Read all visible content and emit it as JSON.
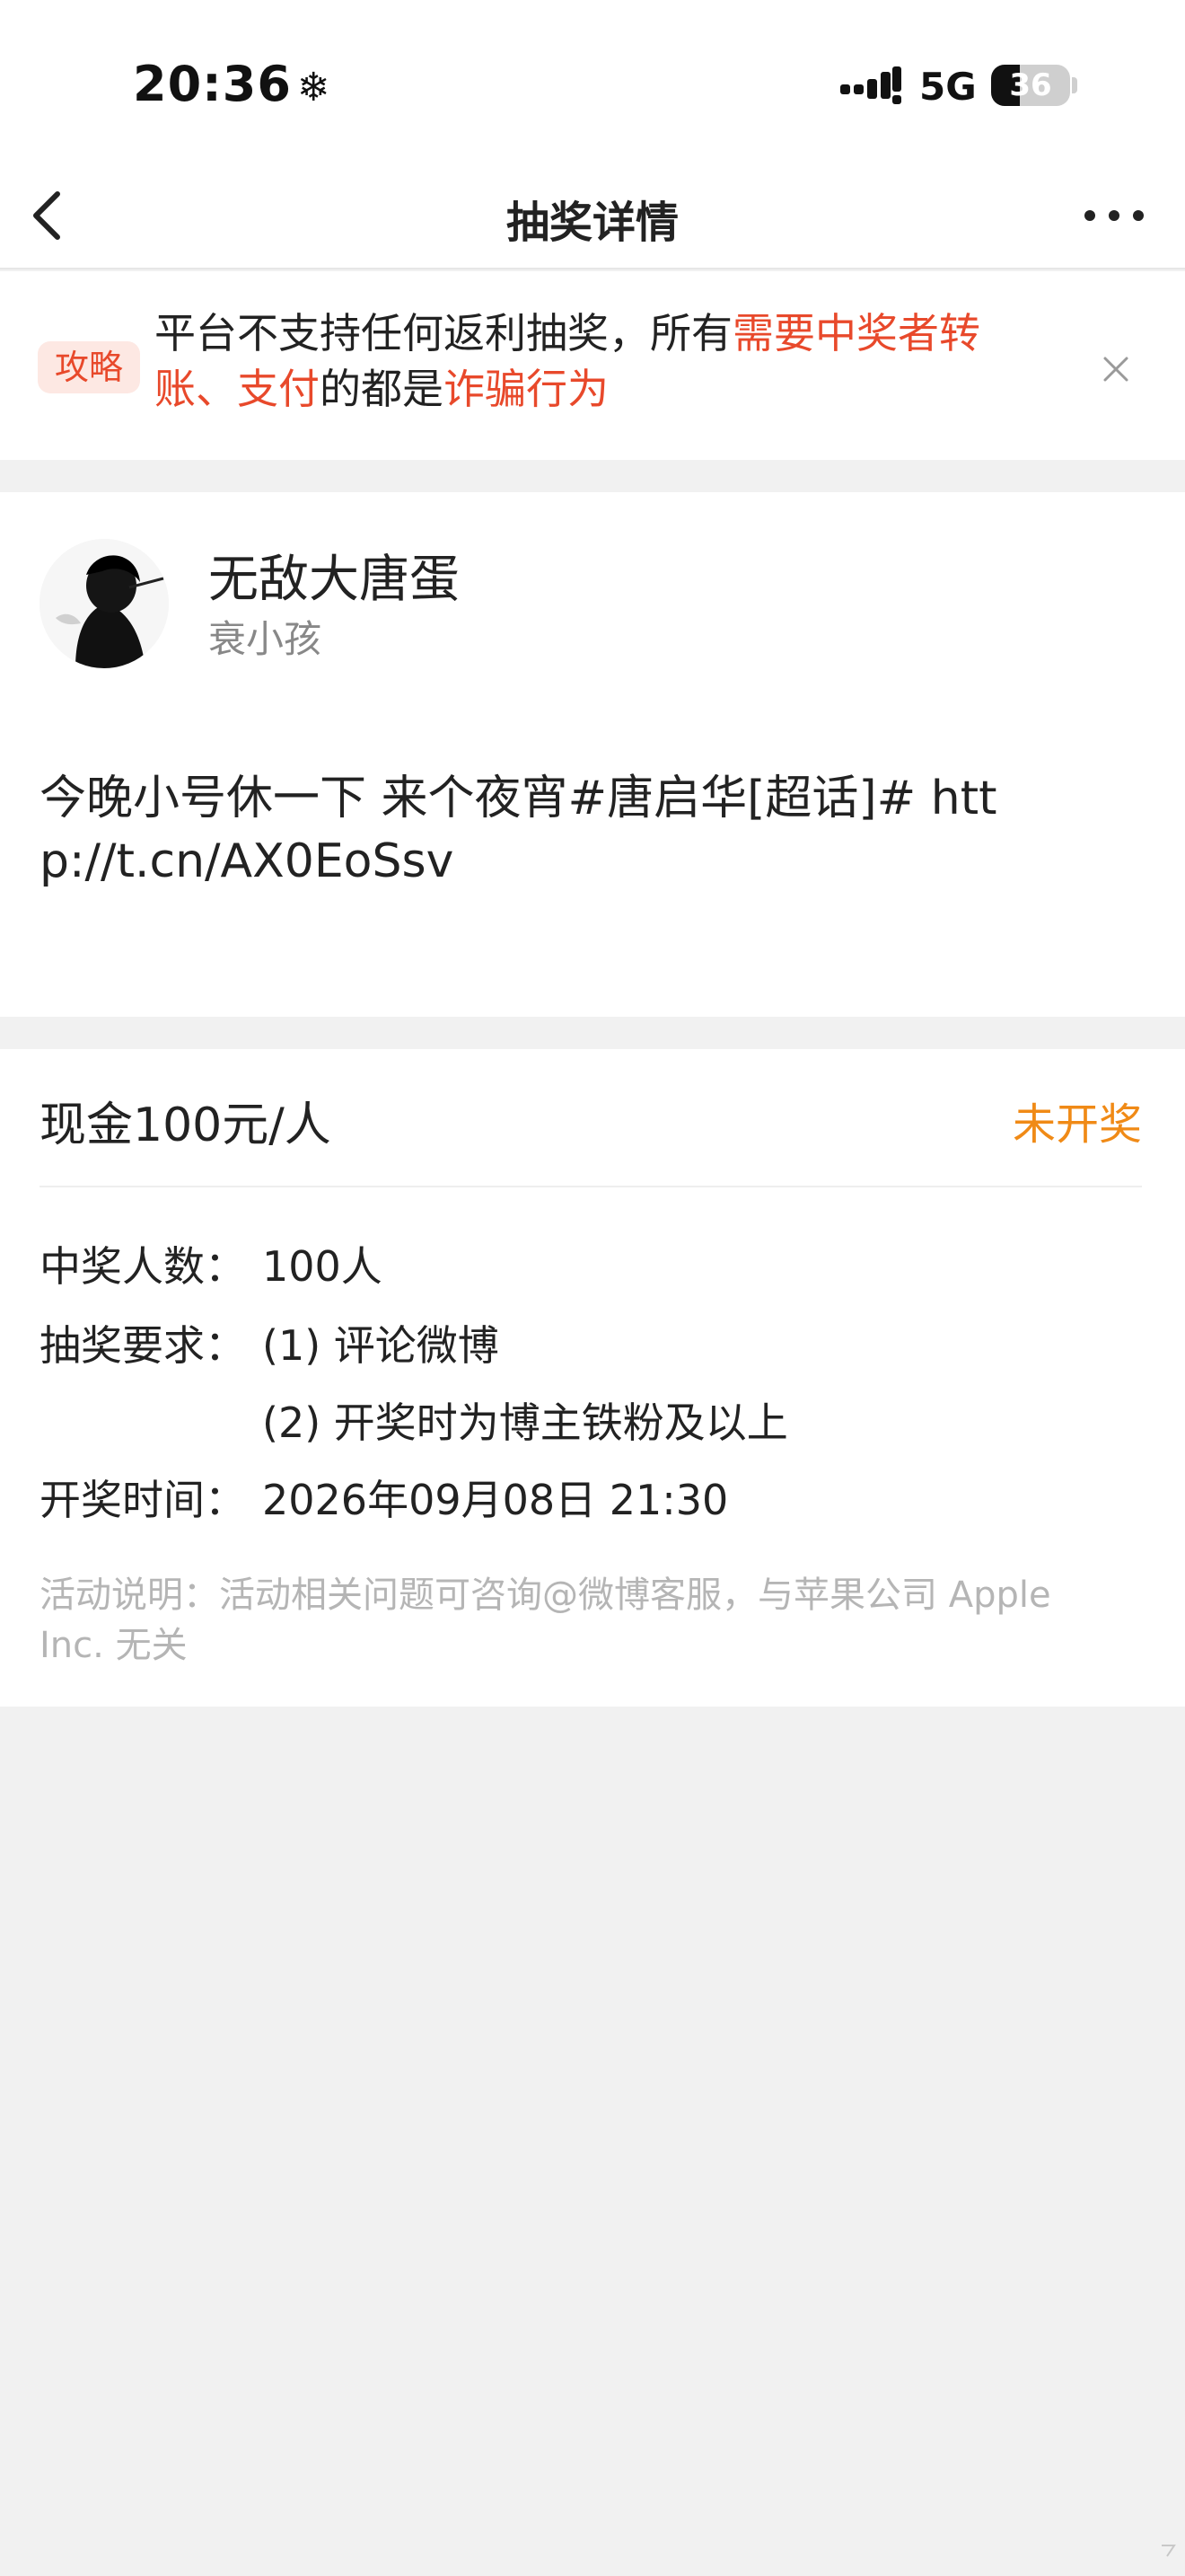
{
  "status_bar": {
    "time": "20:36",
    "time_icon": "snowflake-icon",
    "network": "5G",
    "battery": "36",
    "battery_level_percent": 36
  },
  "nav": {
    "title": "抽奖详情",
    "back_icon": "chevron-left-icon",
    "more_icon": "more-dots-icon"
  },
  "banner": {
    "tag": "攻略",
    "text_part1": "平台不支持任何返利抽奖，所有",
    "text_red1": "需要中奖者转账、支付",
    "text_part2": "的都是",
    "text_red2": "诈骗行为",
    "close_icon": "close-icon",
    "accent_color": "#e8492b"
  },
  "post": {
    "user_name": "无敌大唐蛋",
    "user_sub": "衰小孩",
    "content": "今晚小号休一下 来个夜宵#唐启华[超话]#   http://t.cn/AX0EoSsv"
  },
  "prize": {
    "title": "现金100元/人",
    "status": "未开奖",
    "status_color": "#f08a16",
    "winners_label": "中奖人数：",
    "winners_value": "100人",
    "requirements_label": "抽奖要求：",
    "requirement_1": "(1) 评论微博",
    "requirement_2": "(2) 开奖时为博主铁粉及以上",
    "draw_time_label": "开奖时间：",
    "draw_time_value": "2026年09月08日 21:30",
    "notice": "活动说明：活动相关问题可咨询@微博客服，与苹果公司 Apple Inc. 无关"
  }
}
